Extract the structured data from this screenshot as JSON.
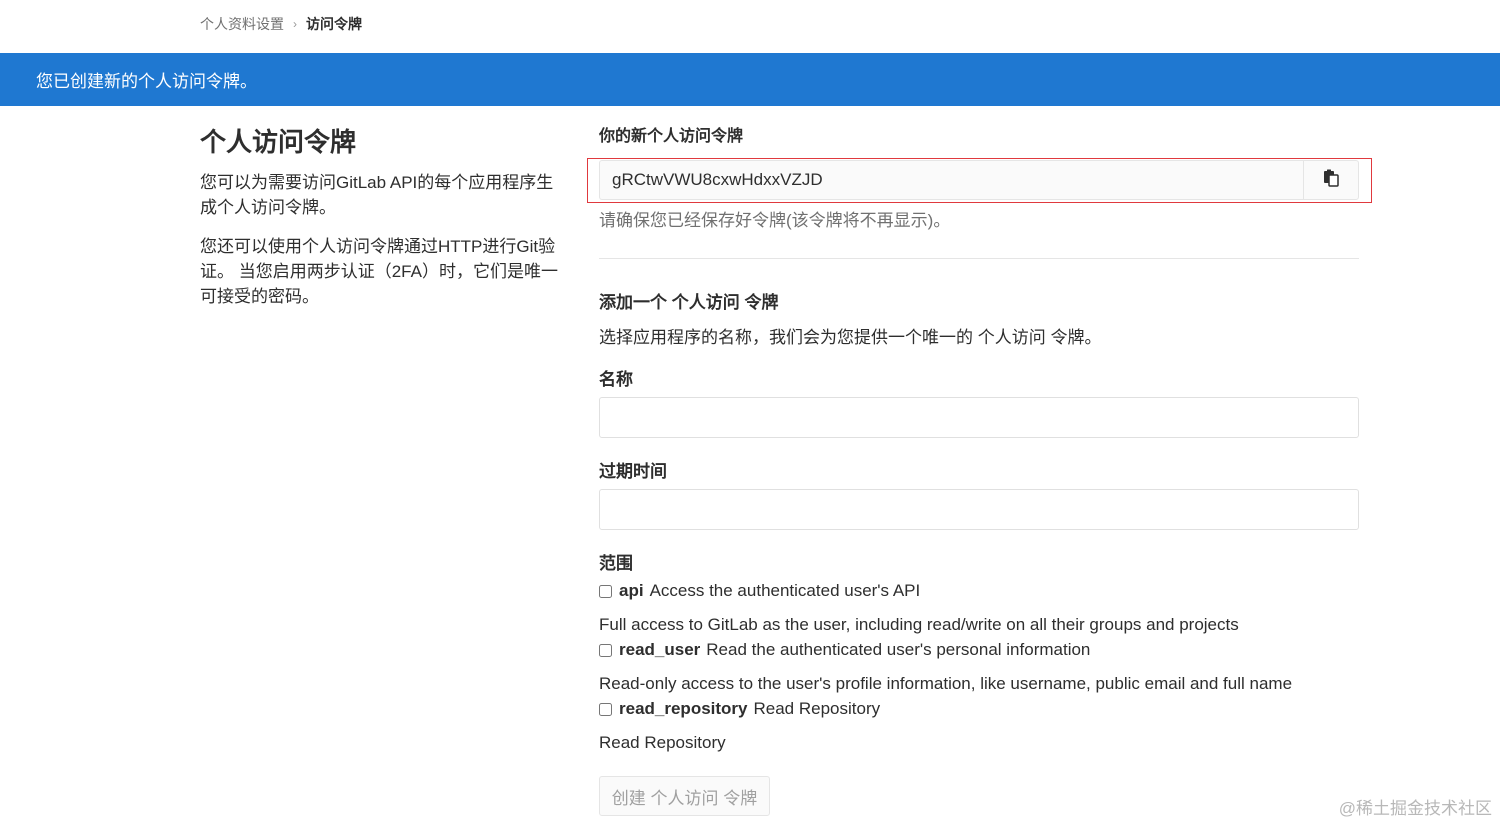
{
  "breadcrumb": {
    "parent": "个人资料设置",
    "separator": "›",
    "current": "访问令牌"
  },
  "flash": {
    "message": "您已创建新的个人访问令牌。"
  },
  "intro": {
    "title": "个人访问令牌",
    "paragraph1": "您可以为需要访问GitLab API的每个应用程序生成个人访问令牌。",
    "paragraph2": "您还可以使用个人访问令牌通过HTTP进行Git验证。 当您启用两步认证（2FA）时，它们是唯一可接受的密码。"
  },
  "new_token": {
    "label": "你的新个人访问令牌",
    "value": "gRCtwVWU8cxwHdxxVZJD",
    "copy_icon": "clipboard-icon",
    "help": "请确保您已经保存好令牌(该令牌将不再显示)。"
  },
  "add_token": {
    "title": "添加一个 个人访问 令牌",
    "description": "选择应用程序的名称，我们会为您提供一个唯一的 个人访问 令牌。",
    "name_label": "名称",
    "name_value": "",
    "expires_label": "过期时间",
    "expires_value": "",
    "scopes_label": "范围",
    "scopes": [
      {
        "name": "api",
        "summary": "Access the authenticated user's API",
        "help": "Full access to GitLab as the user, including read/write on all their groups and projects",
        "checked": false
      },
      {
        "name": "read_user",
        "summary": "Read the authenticated user's personal information",
        "help": "Read-only access to the user's profile information, like username, public email and full name",
        "checked": false
      },
      {
        "name": "read_repository",
        "summary": "Read Repository",
        "help": "Read Repository",
        "checked": false
      }
    ],
    "submit_label": "创建 个人访问 令牌"
  },
  "watermark": "@稀土掘金技术社区",
  "colors": {
    "flash_bg": "#1f78d1",
    "highlight_border": "#e0393e"
  }
}
